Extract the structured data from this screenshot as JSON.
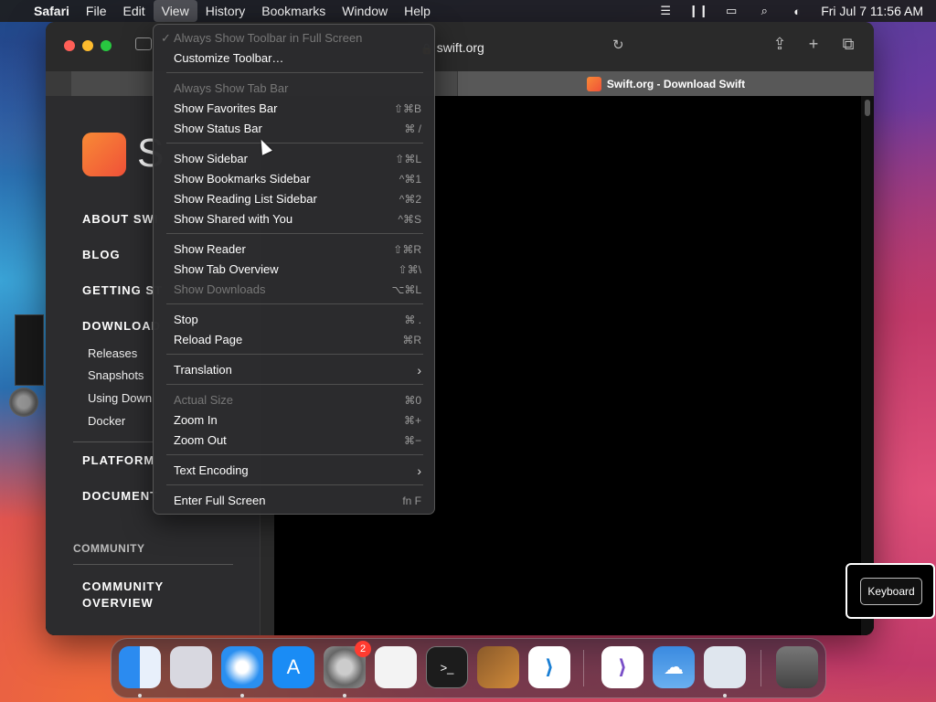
{
  "menubar": {
    "items": [
      "Safari",
      "File",
      "Edit",
      "View",
      "History",
      "Bookmarks",
      "Window",
      "Help"
    ],
    "clock": "Fri Jul 7  11:56 AM"
  },
  "browser": {
    "url": "swift.org",
    "tab_title": "Swift.org - Download Swift"
  },
  "site_sidebar": {
    "logo_letter": "S",
    "links": [
      "ABOUT SWI",
      "BLOG",
      "GETTING ST",
      "DOWNLOAD",
      "PLATFORM",
      "DOCUMENT"
    ],
    "download_sub": [
      "Releases",
      "Snapshots",
      "Using Downl",
      "Docker"
    ],
    "community_heading": "COMMUNITY",
    "community_overview": "COMMUNITY OVERVIEW"
  },
  "view_menu": {
    "items": [
      {
        "label": "Always Show Toolbar in Full Screen",
        "shortcut": "",
        "disabled": true,
        "checked": true
      },
      {
        "label": "Customize Toolbar…",
        "shortcut": "",
        "disabled": false
      },
      {
        "label": "Always Show Tab Bar",
        "shortcut": "",
        "disabled": true
      },
      {
        "label": "Show Favorites Bar",
        "shortcut": "⇧⌘B",
        "disabled": false
      },
      {
        "label": "Show Status Bar",
        "shortcut": "⌘ /",
        "disabled": false
      },
      {
        "label": "Show Sidebar",
        "shortcut": "⇧⌘L",
        "disabled": false
      },
      {
        "label": "Show Bookmarks Sidebar",
        "shortcut": "^⌘1",
        "disabled": false
      },
      {
        "label": "Show Reading List Sidebar",
        "shortcut": "^⌘2",
        "disabled": false
      },
      {
        "label": "Show Shared with You",
        "shortcut": "^⌘S",
        "disabled": false
      },
      {
        "label": "Show Reader",
        "shortcut": "⇧⌘R",
        "disabled": false
      },
      {
        "label": "Show Tab Overview",
        "shortcut": "⇧⌘\\",
        "disabled": false
      },
      {
        "label": "Show Downloads",
        "shortcut": "⌥⌘L",
        "disabled": true
      },
      {
        "label": "Stop",
        "shortcut": "⌘ .",
        "disabled": false
      },
      {
        "label": "Reload Page",
        "shortcut": "⌘R",
        "disabled": false
      },
      {
        "label": "Translation",
        "shortcut": "",
        "submenu": true
      },
      {
        "label": "Actual Size",
        "shortcut": "⌘0",
        "disabled": true
      },
      {
        "label": "Zoom In",
        "shortcut": "⌘+",
        "disabled": false
      },
      {
        "label": "Zoom Out",
        "shortcut": "⌘−",
        "disabled": false
      },
      {
        "label": "Text Encoding",
        "shortcut": "",
        "submenu": true
      },
      {
        "label": "Enter Full Screen",
        "shortcut": "fn F",
        "disabled": false
      }
    ]
  },
  "keyboard_button": "Keyboard",
  "dock": {
    "settings_badge": "2",
    "apps": [
      "finder-icon",
      "launchpad-icon",
      "safari-icon",
      "app-store-icon",
      "system-settings-icon",
      "textedit-icon",
      "terminal-icon",
      "garageband-icon",
      "vscode-icon",
      "visual-studio-icon",
      "weather-icon",
      "xcode-icon",
      "trash-icon"
    ]
  }
}
